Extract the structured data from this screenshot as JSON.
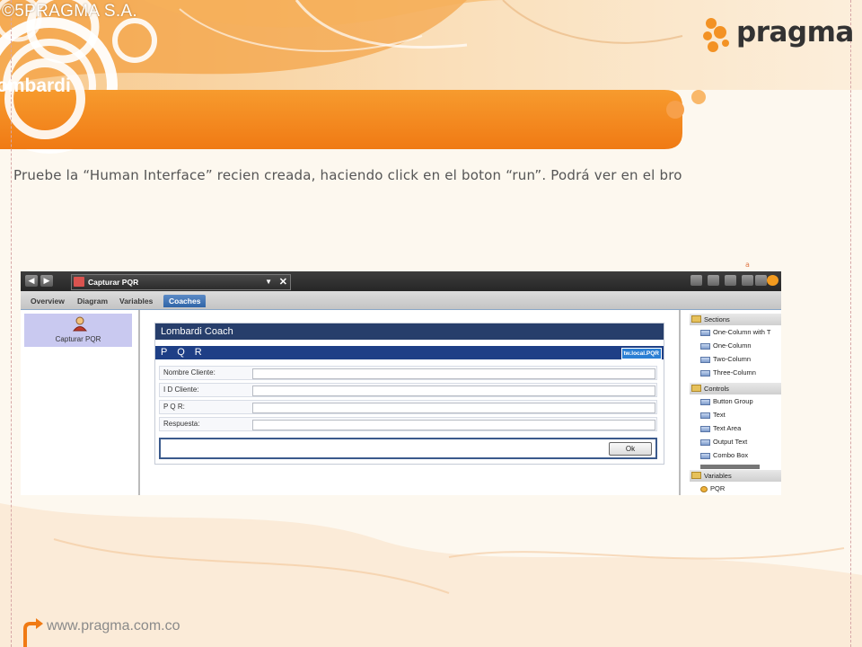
{
  "slide": {
    "copyright": "©5PRAGMA S.A.",
    "title": "ombardi",
    "logo_text": "pragma",
    "instruction": "Pruebe la “Human Interface” recien creada, haciendo click en el boton “run”.  Podrá ver en el bro",
    "footer_url": "www.pragma.com.co",
    "tiny_mark": "a",
    "colors": {
      "orange": "#f4871f",
      "light_orange": "#f9b24a",
      "cream": "#fdf8ef"
    }
  },
  "app": {
    "toolbar": {
      "back_glyph": "◀",
      "forward_glyph": "▶",
      "document_title": "Capturar PQR",
      "combo_caret": "▼",
      "close_glyph": "✕",
      "right_icons": [
        "layout-icon",
        "columns-icon",
        "list-icon",
        "gear-icon",
        "settings-icon",
        "run-icon"
      ]
    },
    "tabs": [
      "Overview",
      "Diagram",
      "Variables",
      "Coaches"
    ],
    "active_tab": "Coaches",
    "left_panel": {
      "item_label": "Capturar PQR",
      "item_icon": "person-icon"
    },
    "coach": {
      "header": "Lombardi Coach",
      "section_title": "P Q R",
      "binding_badge": "tw.local.PQR",
      "fields": [
        {
          "label": "Nombre Cliente:",
          "value": ""
        },
        {
          "label": "I D Cliente:",
          "value": ""
        },
        {
          "label": "P Q R:",
          "value": ""
        },
        {
          "label": "Respuesta:",
          "value": ""
        }
      ],
      "ok_button": "Ok"
    },
    "palette": {
      "sections_header": "Sections",
      "sections": [
        "One-Column with T",
        "One-Column",
        "Two-Column",
        "Three-Column"
      ],
      "controls_header": "Controls",
      "controls": [
        "Button Group",
        "Text",
        "Text Area",
        "Output Text",
        "Combo Box"
      ],
      "variables_header": "Variables",
      "variables": [
        "PQR"
      ]
    }
  }
}
